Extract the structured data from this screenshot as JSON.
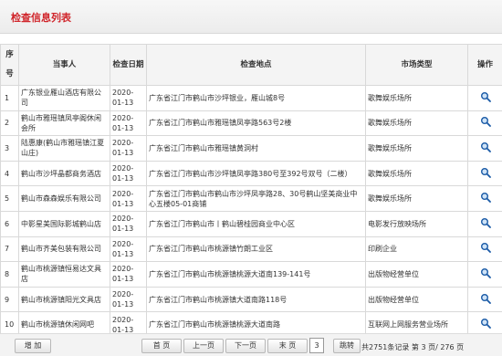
{
  "title": "检查信息列表",
  "headers": {
    "no": "序号",
    "party": "当事人",
    "date": "检查日期",
    "place": "检查地点",
    "type": "市场类型",
    "op": "操作"
  },
  "rows": [
    {
      "no": "1",
      "party": "广东银业雁山酒店有限公司",
      "date": "2020-01-13",
      "place": "广东省江门市鹤山市沙坪银业，雁山城8号",
      "type": "歌舞娱乐场所"
    },
    {
      "no": "2",
      "party": "鹤山市雅瑶镇凤亭阁休闲会所",
      "date": "2020-01-13",
      "place": "广东省江门市鹤山市雅瑶镇凤亭路563号2楼",
      "type": "歌舞娱乐场所"
    },
    {
      "no": "3",
      "party": "陆惠康(鹤山市雅瑶镇江夏山庄)",
      "date": "2020-01-13",
      "place": "广东省江门市鹤山市雅瑶镇黄洞村",
      "type": "歌舞娱乐场所"
    },
    {
      "no": "4",
      "party": "鹤山市沙坪晶都商务酒店",
      "date": "2020-01-13",
      "place": "广东省江门市鹤山市沙坪镇凤亭路380号至392号双号（二楼）",
      "type": "歌舞娱乐场所"
    },
    {
      "no": "5",
      "party": "鹤山市森森娱乐有限公司",
      "date": "2020-01-13",
      "place": "广东省江门市鹤山市鹤山市沙坪凤亭路28、30号鹤山坚美商业中心五楼05-01商铺",
      "type": "歌舞娱乐场所"
    },
    {
      "no": "6",
      "party": "中影星美国际影城鹤山店",
      "date": "2020-01-13",
      "place": "广东省江门市鹤山市丨鹤山碧桂园商业中心区",
      "type": "电影发行放映场所"
    },
    {
      "no": "7",
      "party": "鹤山市齐美包装有限公司",
      "date": "2020-01-13",
      "place": "广东省江门市鹤山市桃源镇竹朗工业区",
      "type": "印刷企业"
    },
    {
      "no": "8",
      "party": "鹤山市桃源镇恒易达文具店",
      "date": "2020-01-13",
      "place": "广东省江门市鹤山市桃源镇桃源大道南139-141号",
      "type": "出版物经营单位"
    },
    {
      "no": "9",
      "party": "鹤山市桃源镇阳光文具店",
      "date": "2020-01-13",
      "place": "广东省江门市鹤山市桃源镇大道南路118号",
      "type": "出版物经营单位"
    },
    {
      "no": "10",
      "party": "鹤山市桃源镇休闲网吧",
      "date": "2020-01-13",
      "place": "广东省江门市鹤山市桃源镇桃源大道南路",
      "type": "互联网上网服务营业场所"
    }
  ],
  "footer": {
    "add": "增 加",
    "first": "首 页",
    "prev": "上一页",
    "next": "下一页",
    "last": "末 页",
    "page_value": "3",
    "jump": "跳转",
    "info": "共2751条记录 第 3 页/ 276 页"
  },
  "colors": {
    "title": "#d0252b",
    "link": "#1a5aa6"
  }
}
